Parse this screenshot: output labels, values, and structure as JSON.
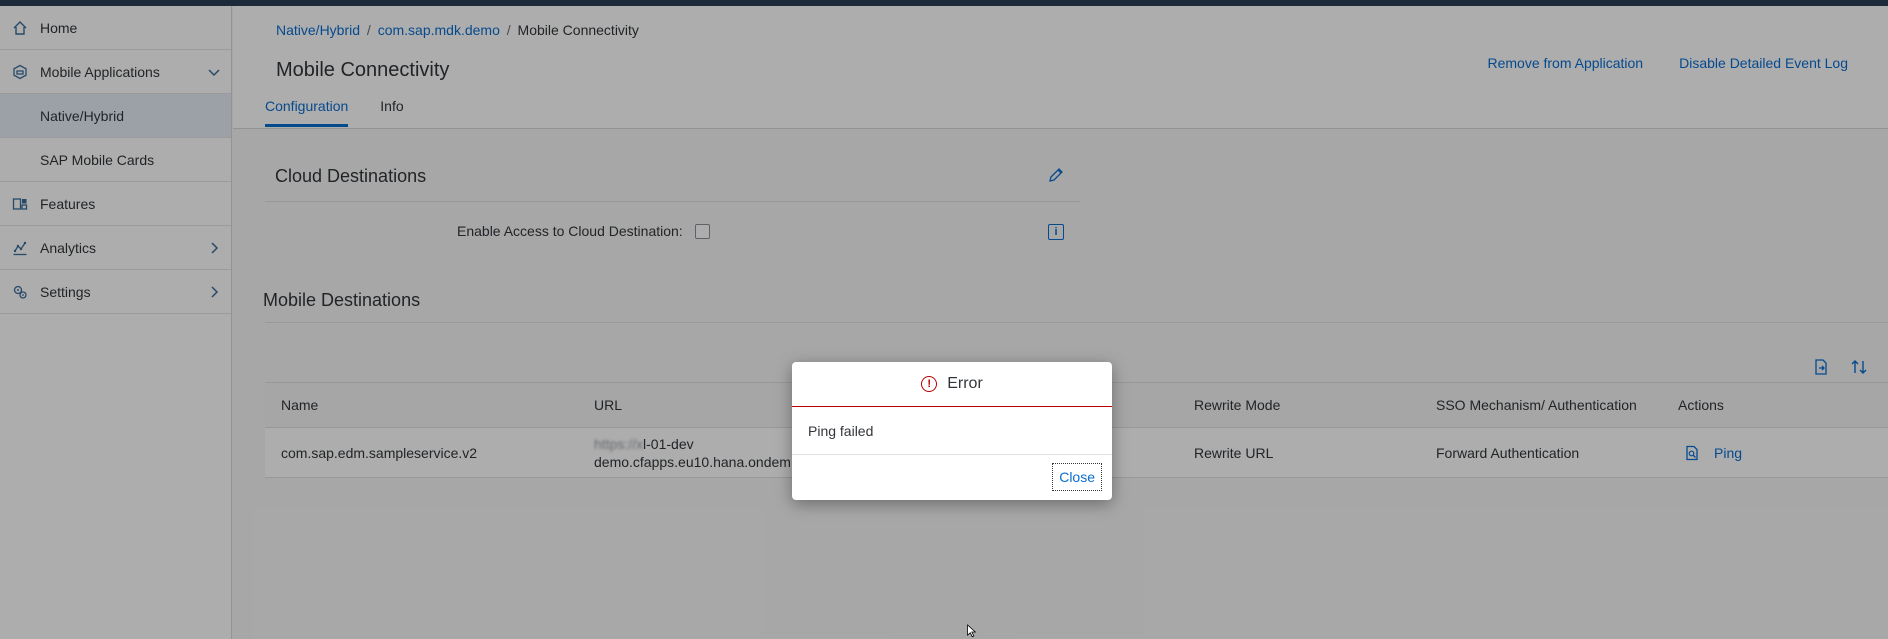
{
  "sidebar": {
    "items": [
      {
        "label": "Home",
        "icon": "home-icon"
      },
      {
        "label": "Mobile Applications",
        "icon": "cube-icon",
        "chevron": "down"
      },
      {
        "label": "Native/Hybrid",
        "selected": true
      },
      {
        "label": "SAP Mobile Cards"
      },
      {
        "label": "Features",
        "icon": "features-icon"
      },
      {
        "label": "Analytics",
        "icon": "analytics-icon",
        "chevron": "right"
      },
      {
        "label": "Settings",
        "icon": "settings-icon",
        "chevron": "right"
      }
    ]
  },
  "breadcrumb": {
    "crumb1": "Native/Hybrid",
    "crumb2": "com.sap.mdk.demo",
    "current": "Mobile Connectivity",
    "separator": "/"
  },
  "page": {
    "title": "Mobile Connectivity",
    "actions": {
      "remove": "Remove from Application",
      "disable_log": "Disable Detailed Event Log"
    },
    "tabs": [
      {
        "label": "Configuration",
        "active": true
      },
      {
        "label": "Info",
        "active": false
      }
    ]
  },
  "cloud": {
    "title": "Cloud Destinations",
    "enable_label": "Enable Access to Cloud Destination:",
    "enabled": false
  },
  "mobile": {
    "title": "Mobile Destinations",
    "columns": {
      "name": "Name",
      "url": "URL",
      "rewrite": "Rewrite Mode",
      "sso": "SSO Mechanism/ Authentication",
      "actions": "Actions"
    },
    "rows": [
      {
        "name": "com.sap.edm.sampleservice.v2",
        "url_line1_obscured": "https://x",
        "url_line1_visible": "l-01-dev",
        "url_line2": "demo.cfapps.eu10.hana.ondem",
        "rewrite": "Rewrite URL",
        "sso": "Forward Authentication",
        "action": "Ping"
      }
    ]
  },
  "dialog": {
    "title": "Error",
    "message": "Ping failed",
    "close": "Close"
  },
  "colors": {
    "accent": "#0a6ed1",
    "error": "#bb0000",
    "topbar": "#2c3e55",
    "selected": "#e5eef5"
  }
}
